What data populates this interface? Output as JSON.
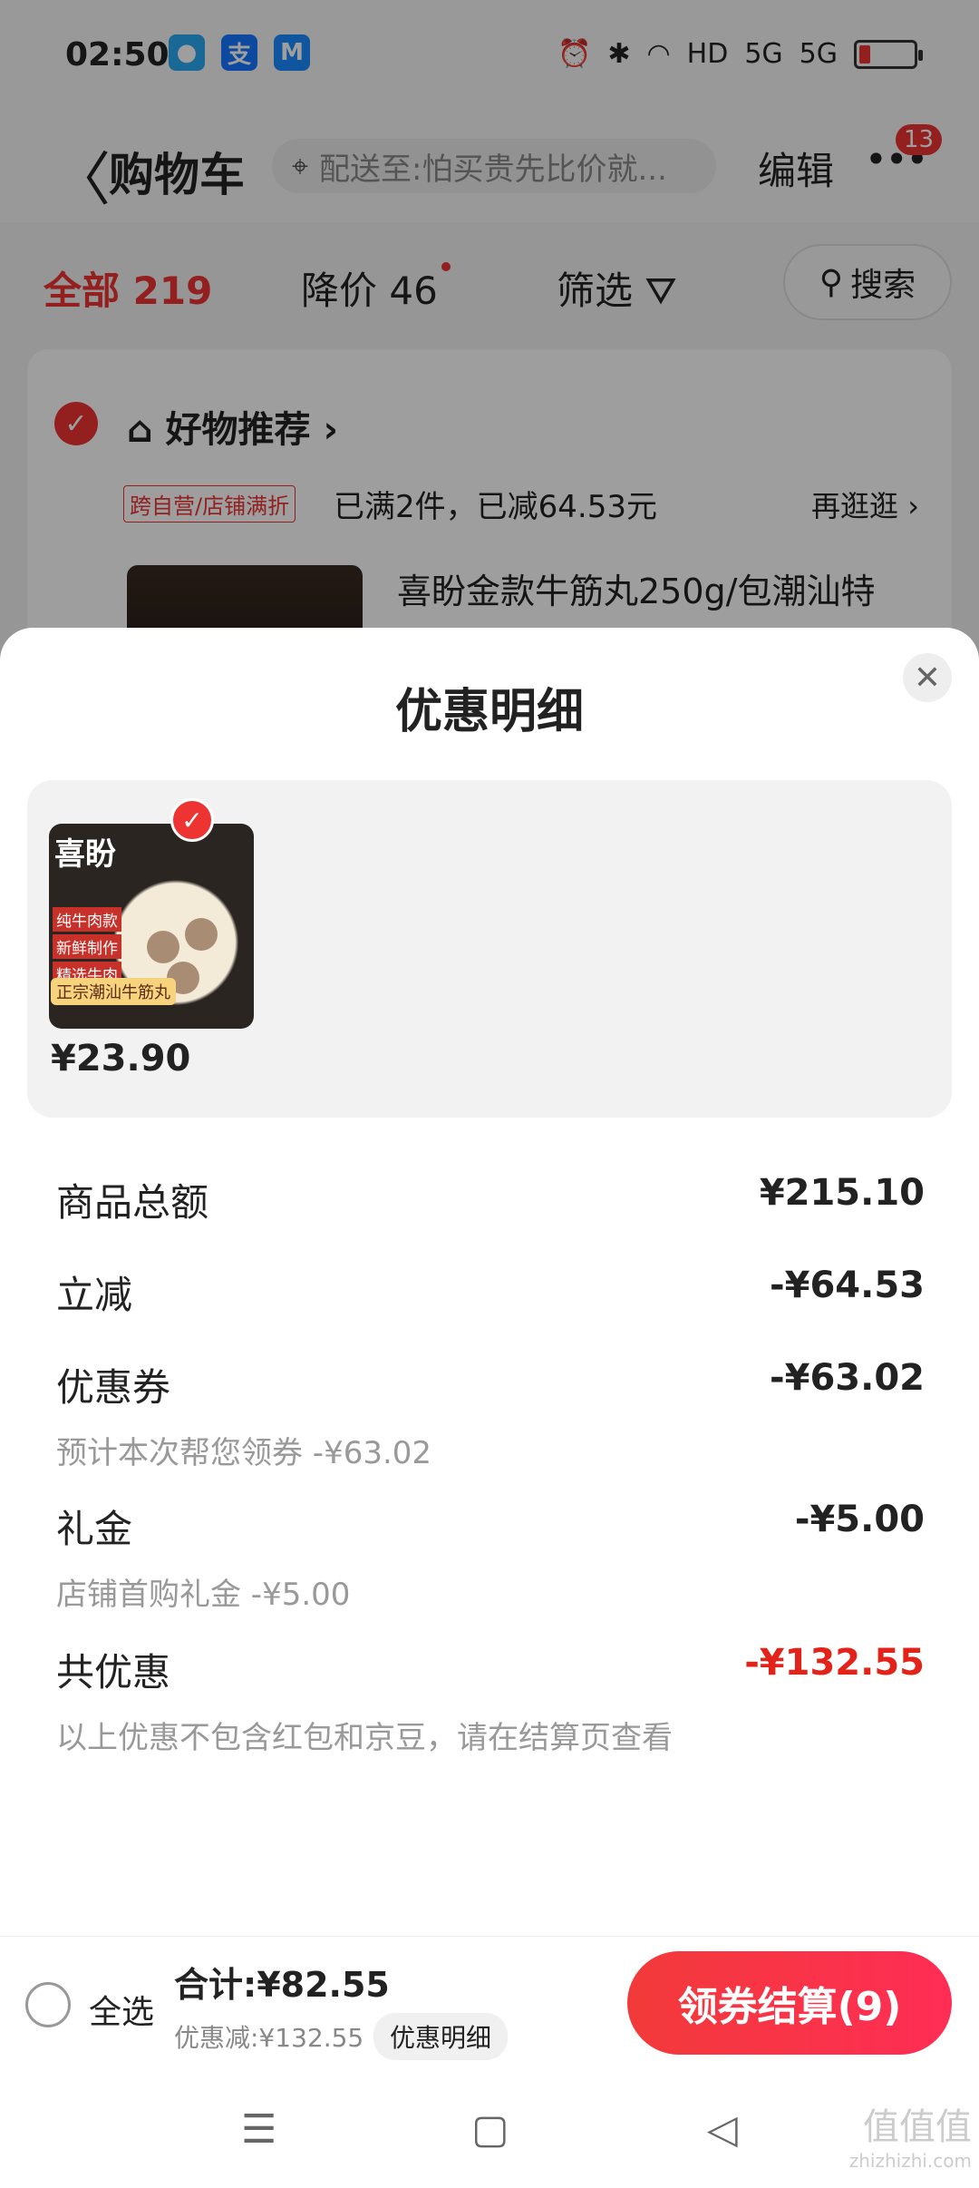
{
  "status_bar": {
    "time": "02:50",
    "right_icons": [
      "alarm-icon",
      "bluetooth-icon",
      "wifi-icon",
      "HD",
      "5G",
      "5G"
    ]
  },
  "nav": {
    "back": "〈",
    "title": "购物车",
    "address": "配送至:怕买贵先比价就...",
    "edit": "编辑",
    "more_badge": "13"
  },
  "tabs": {
    "all": "全部 219",
    "price_drop": "降价 46",
    "filter": "筛选",
    "search": "搜索"
  },
  "cart_card": {
    "shop": "好物推荐 ›",
    "promo_tag": "跨自营/店铺满折",
    "promo_text": "已满2件，已减64.53元",
    "more": "再逛逛 ›",
    "product_title": "喜盼金款牛筋丸250g/包潮汕特"
  },
  "sheet": {
    "title": "优惠明细",
    "close": "✕",
    "product": {
      "logo": "喜盼",
      "tags": [
        "纯牛肉款",
        "新鲜制作",
        "精选牛肉"
      ],
      "ribbon": "正宗潮汕牛筋丸",
      "price": "¥23.90"
    },
    "rows": {
      "subtotal": {
        "label": "商品总额",
        "value": "¥215.10"
      },
      "instant": {
        "label": "立减",
        "value": "-¥64.53"
      },
      "coupon": {
        "label": "优惠券",
        "value": "-¥63.02",
        "sub": "预计本次帮您领券 -¥63.02"
      },
      "gift": {
        "label": "礼金",
        "value": "-¥5.00",
        "sub": "店铺首购礼金 -¥5.00"
      },
      "total": {
        "label": "共优惠",
        "value": "-¥132.55",
        "sub": "以上优惠不包含红包和京豆，请在结算页查看"
      }
    }
  },
  "bottom_bar": {
    "select_all": "全选",
    "total": "合计:¥82.55",
    "discount": "优惠减:¥132.55",
    "detail": "优惠明细",
    "checkout": "领券结算(9)"
  },
  "system_nav": {
    "menu": "☰",
    "home": "▢",
    "back": "◁"
  },
  "watermark": {
    "main": "值值值",
    "sub": "zhizhizhi.com"
  },
  "colors": {
    "accent": "#e2231a",
    "checkout_start": "#f23a3a",
    "checkout_end": "#ff2d55"
  }
}
